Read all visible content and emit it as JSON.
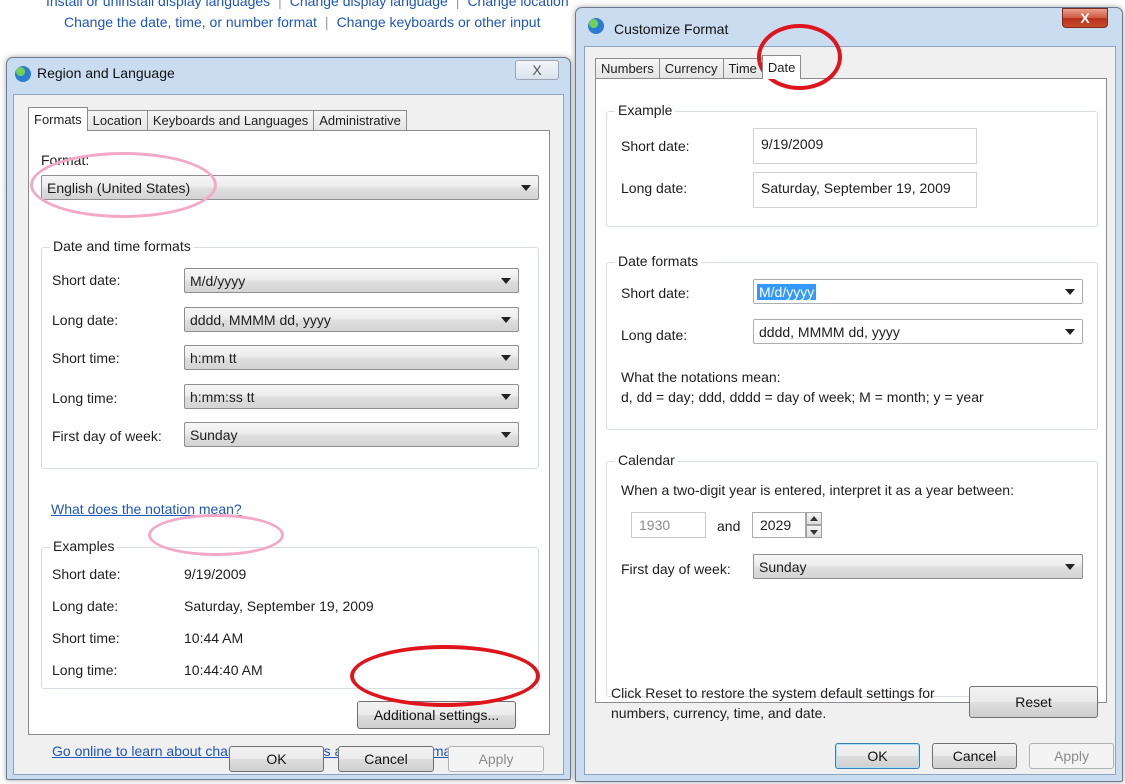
{
  "background": {
    "row1": [
      "Install or uninstall display languages",
      "Change display language",
      "Change location"
    ],
    "row2": [
      "Change the date, time, or number format",
      "Change keyboards or other input"
    ]
  },
  "region": {
    "title": "Region and Language",
    "close": "X",
    "tabs": [
      "Formats",
      "Location",
      "Keyboards and Languages",
      "Administrative"
    ],
    "format_label": "Format:",
    "format_value": "English (United States)",
    "dt_group": "Date and time formats",
    "rows": [
      {
        "label": "Short date:",
        "value": "M/d/yyyy"
      },
      {
        "label": "Long date:",
        "value": "dddd, MMMM dd, yyyy"
      },
      {
        "label": "Short time:",
        "value": "h:mm tt"
      },
      {
        "label": "Long time:",
        "value": "h:mm:ss tt"
      },
      {
        "label": "First day of week:",
        "value": "Sunday"
      }
    ],
    "notation_link": "What does the notation mean?",
    "examples_group": "Examples",
    "examples": [
      {
        "label": "Short date:",
        "value": "9/19/2009"
      },
      {
        "label": "Long date:",
        "value": "Saturday, September 19, 2009"
      },
      {
        "label": "Short time:",
        "value": "10:44 AM"
      },
      {
        "label": "Long time:",
        "value": "10:44:40 AM"
      }
    ],
    "additional": "Additional settings...",
    "online_link": "Go online to learn about changing languages and regional formats",
    "ok": "OK",
    "cancel": "Cancel",
    "apply": "Apply"
  },
  "customize": {
    "title": "Customize Format",
    "close": "X",
    "tabs": [
      "Numbers",
      "Currency",
      "Time",
      "Date"
    ],
    "example_group": "Example",
    "short_date_label": "Short date:",
    "short_date_value": "9/19/2009",
    "long_date_label": "Long date:",
    "long_date_value": "Saturday, September 19, 2009",
    "formats_group": "Date formats",
    "short_fmt_label": "Short date:",
    "short_fmt_value": "M/d/yyyy",
    "long_fmt_label": "Long date:",
    "long_fmt_value": "dddd, MMMM dd, yyyy",
    "notation_title": "What the notations mean:",
    "notation_text": "d, dd = day;  ddd, dddd = day of week;  M = month;  y = year",
    "calendar_group": "Calendar",
    "two_digit_text": "When a two-digit year is entered, interpret it as a year between:",
    "year_from": "1930",
    "and": "and",
    "year_to": "2029",
    "first_day_label": "First day of week:",
    "first_day_value": "Sunday",
    "reset_text_1": "Click Reset to restore the system default settings for",
    "reset_text_2": "numbers, currency, time, and date.",
    "reset": "Reset",
    "ok": "OK",
    "cancel": "Cancel",
    "apply": "Apply"
  },
  "colors": {
    "link": "#1f56b8",
    "pink_mark": "#f3a8c8",
    "red_mark": "#e0141b",
    "selection": "#3399ff"
  }
}
